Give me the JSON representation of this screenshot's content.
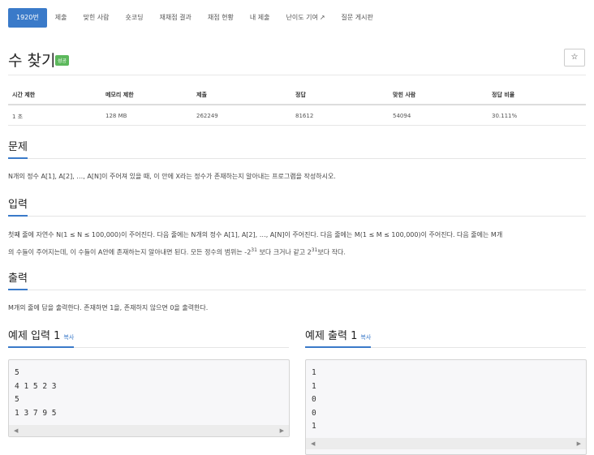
{
  "tabs": [
    {
      "label": "1920번",
      "active": true
    },
    {
      "label": "제출"
    },
    {
      "label": "맞힌 사람"
    },
    {
      "label": "숏코딩"
    },
    {
      "label": "재채점 결과"
    },
    {
      "label": "채점 현황"
    },
    {
      "label": "내 제출"
    },
    {
      "label": "난이도 기여",
      "external": true
    },
    {
      "label": "질문 게시판"
    }
  ],
  "problem": {
    "title": "수 찾기",
    "badge": "성공",
    "star_icon": "☆"
  },
  "info": {
    "headers": [
      "시간 제한",
      "메모리 제한",
      "제출",
      "정답",
      "맞힌 사람",
      "정답 비율"
    ],
    "values": [
      "1 초",
      "128 MB",
      "262249",
      "81612",
      "54094",
      "30.111%"
    ]
  },
  "sections": {
    "problem": {
      "title": "문제",
      "text": "N개의 정수 A[1], A[2], …, A[N]이 주어져 있을 때, 이 안에 X라는 정수가 존재하는지 알아내는 프로그램을 작성하시오."
    },
    "input": {
      "title": "입력",
      "line1": "첫째 줄에 자연수 N(1 ≤ N ≤ 100,000)이 주어진다. 다음 줄에는 N개의 정수 A[1], A[2], …, A[N]이 주어진다. 다음 줄에는 M(1 ≤ M ≤ 100,000)이 주어진다. 다음 줄에는 M개",
      "line2_a": "의 수들이 주어지는데, 이 수들이 A안에 존재하는지 알아내면 된다. 모든 정수의 범위는 -2",
      "exp1": "31",
      "line2_b": " 보다 크거나 같고 2",
      "exp2": "31",
      "line2_c": "보다 작다."
    },
    "output": {
      "title": "출력",
      "text": "M개의 줄에 답을 출력한다. 존재하면 1을, 존재하지 않으면 0을 출력한다."
    }
  },
  "example_input": {
    "title": "예제 입력 1",
    "copy": "복사",
    "content": "5\n4 1 5 2 3\n5\n1 3 7 9 5"
  },
  "example_output": {
    "title": "예제 출력 1",
    "copy": "복사",
    "content": "1\n1\n0\n0\n1"
  },
  "colors": {
    "accent": "#3a7ac9",
    "success": "#5cb85c"
  }
}
